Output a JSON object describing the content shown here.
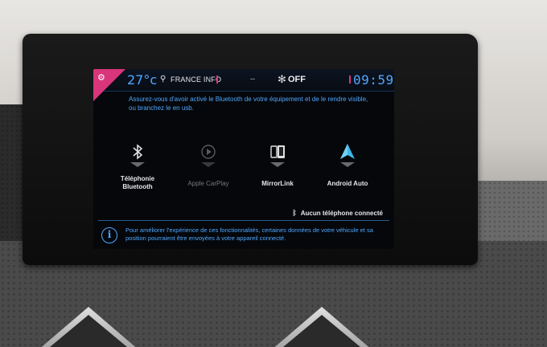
{
  "status_bar": {
    "temperature": "27°c",
    "radio_station": "FRANCE INFO",
    "separator": "--",
    "climate_label": "OFF",
    "time": "09:59"
  },
  "message": "Assurez-vous d'avoir activé le Bluetooth de votre équipement et de le rendre visible, ou branchez le en usb.",
  "tiles": [
    {
      "label_line1": "Téléphonie",
      "label_line2": "Bluetooth",
      "icon": "bluetooth-icon"
    },
    {
      "label_line1": "Apple CarPlay",
      "label_line2": "",
      "icon": "carplay-icon"
    },
    {
      "label_line1": "MirrorLink",
      "label_line2": "",
      "icon": "mirrorlink-icon"
    },
    {
      "label_line1": "Android Auto",
      "label_line2": "",
      "icon": "android-auto-icon"
    }
  ],
  "connection_status": "Aucun téléphone connecté",
  "info_text": "Pour améliorer l'expérience de ces fonctionnalités, certaines données de votre véhicule et sa position pourraient être envoyées à votre appareil connecté.",
  "colors": {
    "accent": "#4fa8ff",
    "corner": "#d9357a",
    "screen_bg": "#05070b"
  }
}
